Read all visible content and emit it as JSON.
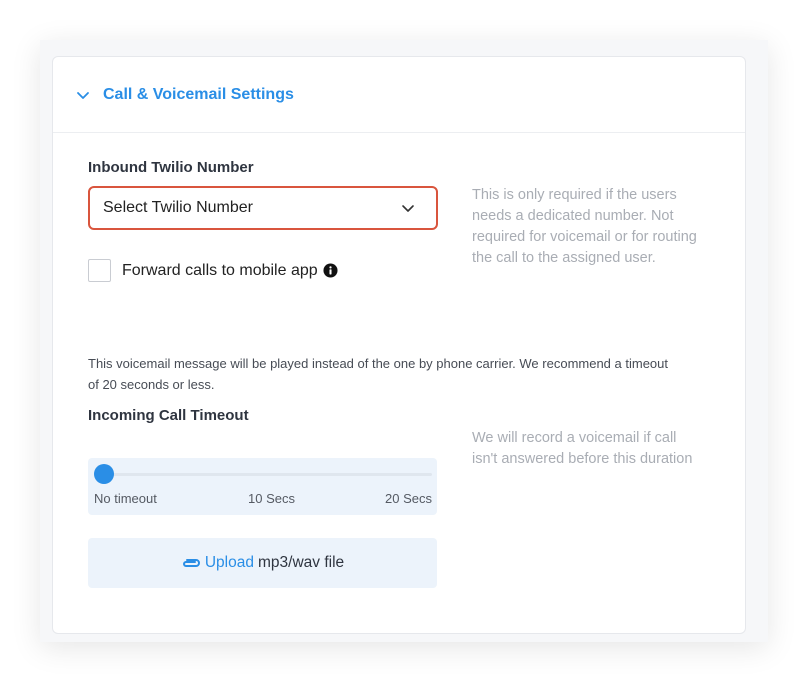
{
  "section": {
    "title": "Call & Voicemail Settings",
    "icon": "chevron-down-icon"
  },
  "inbound": {
    "label": "Inbound Twilio Number",
    "select_value": "Select Twilio Number",
    "help_lines": [
      "This is only required if the users",
      "needs a dedicated number. Not",
      "required for voicemail or for routing",
      "the call to the assigned user."
    ],
    "error_border_color": "#d9553d"
  },
  "forward": {
    "label": "Forward calls to mobile app",
    "checked": false,
    "icon": "info-icon"
  },
  "voicemail": {
    "description_lines": [
      "This voicemail message will be played instead of the one by phone carrier. We recommend a timeout",
      "of 20 seconds or less."
    ]
  },
  "timeout": {
    "label": "Incoming Call Timeout",
    "help_lines": [
      "We will record a voicemail if call",
      "isn't answered before this duration"
    ],
    "slider_value": 0,
    "ticks": [
      "No timeout",
      "10 Secs",
      "20 Secs"
    ]
  },
  "upload": {
    "icon": "paperclip-icon",
    "link_label": "Upload",
    "suffix": "mp3/wav file"
  },
  "colors": {
    "accent": "#2a8ee6",
    "panel_bg": "#ecf3fb"
  }
}
